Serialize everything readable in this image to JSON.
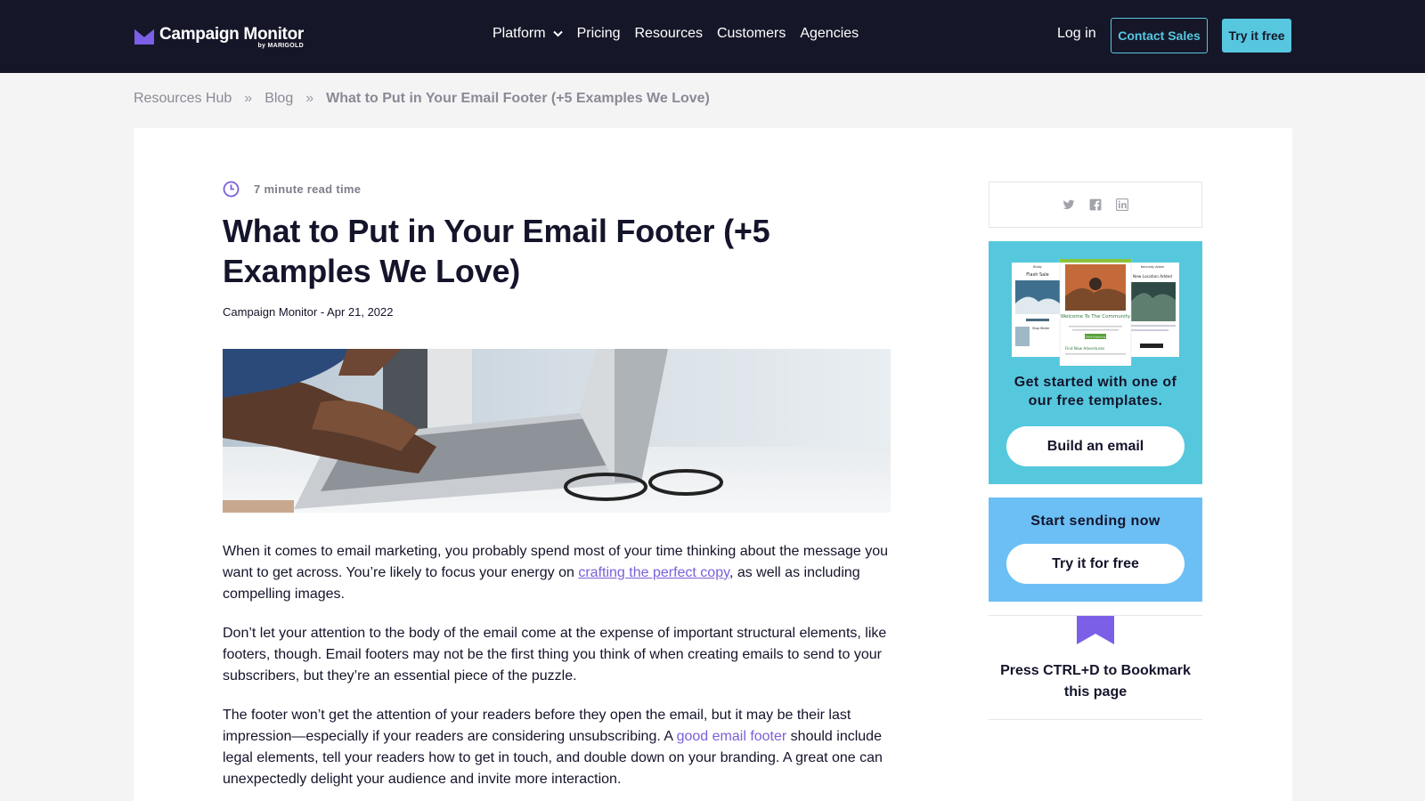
{
  "brand": {
    "name": "Campaign Monitor",
    "sub": "by MARIGOLD"
  },
  "nav": {
    "items": [
      {
        "label": "Platform"
      },
      {
        "label": "Pricing"
      },
      {
        "label": "Resources"
      },
      {
        "label": "Customers"
      },
      {
        "label": "Agencies"
      }
    ],
    "login": "Log in",
    "contact_sales": "Contact Sales",
    "try_free": "Try it free"
  },
  "breadcrumb": {
    "items": [
      "Resources Hub",
      "Blog"
    ],
    "separator": "»",
    "current": "What to Put in Your Email Footer (+5 Examples We Love)"
  },
  "article": {
    "read_time": "7 minute read time",
    "title": "What to Put in Your Email Footer (+5 Examples We Love)",
    "byline": "Campaign Monitor - Apr 21, 2022",
    "p1": {
      "a": "When it comes to email marketing, you probably spend most of your time thinking about the message you want to get across. You’re likely to focus your energy on ",
      "link": "crafting the perfect copy",
      "b": ", as well as including compelling images."
    },
    "p2": "Don’t let your attention to the body of the email come at the expense of important structural elements, like footers, though. Email footers may not be the first thing you think of when creating emails to send to your subscribers, but they’re an essential piece of the puzzle.",
    "p3": {
      "a": "The footer won’t get the attention of your readers before they open the email, but it may be their last impression—especially if your readers are considering unsubscribing. A ",
      "link": "good email footer",
      "b": " should include legal elements, tell your readers how to get in touch, and double down on your branding. A great one can unexpectedly delight your audience and invite more interaction."
    }
  },
  "sidebar": {
    "share_icons": [
      "twitter-icon",
      "facebook-icon",
      "linkedin-icon"
    ],
    "templates": {
      "art": {
        "left_title": "Flash Sale",
        "left_header": "Bixby",
        "center_title": "Welcome To The Community",
        "center_button": "Start Exploring",
        "center_footer": "Find New Adventures",
        "right_header": "Kennedy Adam",
        "right_title": "New Location Added",
        "left_bottom": "Shop Winter"
      },
      "text": "Get started with one of our free templates.",
      "button": "Build an email"
    },
    "send": {
      "text": "Start sending now",
      "button": "Try it for free"
    },
    "bookmark": {
      "text": "Press CTRL+D to Bookmark this page"
    }
  },
  "colors": {
    "nav_bg": "#151728",
    "accent_cyan": "#57c7e0",
    "accent_purple": "#7b5fd9",
    "template_card": "#56c8dd",
    "send_card": "#6bbff5",
    "ribbon": "#7b5fd9"
  }
}
